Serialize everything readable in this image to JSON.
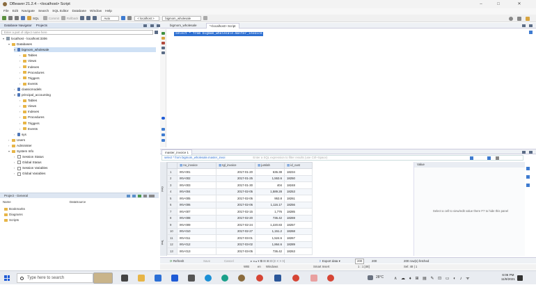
{
  "window": {
    "title": "DBeaver 21.2.4 - <localhost> Script"
  },
  "menu": [
    "File",
    "Edit",
    "Navigate",
    "Search",
    "SQL Editor",
    "Database",
    "Window",
    "Help"
  ],
  "toolbar": {
    "sql_label": "SQL",
    "commit_label": "Commit",
    "rollback_label": "Rollback",
    "auto_label": "Auto",
    "conn_combo": "< localhost >",
    "schema_combo": "bigmom_wholesale"
  },
  "navigator": {
    "header": "Database Navigator",
    "projects_tab": "Projects",
    "filter_placeholder": "Enter a part of object name here",
    "tree": [
      {
        "label": "localhost - localhost:3306",
        "level": 0,
        "kind": "srv",
        "open": true
      },
      {
        "label": "Databases",
        "level": 1,
        "kind": "folder",
        "open": true
      },
      {
        "label": "bigmom_wholesale",
        "level": 2,
        "kind": "db",
        "open": true,
        "selected": true
      },
      {
        "label": "Tables",
        "level": 3,
        "kind": "folder"
      },
      {
        "label": "Views",
        "level": 3,
        "kind": "folder"
      },
      {
        "label": "Indexes",
        "level": 3,
        "kind": "folder"
      },
      {
        "label": "Procedures",
        "level": 3,
        "kind": "folder"
      },
      {
        "label": "Triggers",
        "level": 3,
        "kind": "folder"
      },
      {
        "label": "Events",
        "level": 3,
        "kind": "folder"
      },
      {
        "label": "classicmodels",
        "level": 2,
        "kind": "db"
      },
      {
        "label": "principal_accounting",
        "level": 2,
        "kind": "db",
        "open": true
      },
      {
        "label": "Tables",
        "level": 3,
        "kind": "folder"
      },
      {
        "label": "Views",
        "level": 3,
        "kind": "folder"
      },
      {
        "label": "Indexes",
        "level": 3,
        "kind": "folder"
      },
      {
        "label": "Procedures",
        "level": 3,
        "kind": "folder"
      },
      {
        "label": "Triggers",
        "level": 3,
        "kind": "folder"
      },
      {
        "label": "Events",
        "level": 3,
        "kind": "folder"
      },
      {
        "label": "sys",
        "level": 2,
        "kind": "db"
      },
      {
        "label": "Users",
        "level": 1,
        "kind": "folder"
      },
      {
        "label": "Administer",
        "level": 1,
        "kind": "folder"
      },
      {
        "label": "System Info",
        "level": 1,
        "kind": "folder",
        "open": true
      },
      {
        "label": "Session Status",
        "level": 2,
        "kind": "table"
      },
      {
        "label": "Global Status",
        "level": 2,
        "kind": "table"
      },
      {
        "label": "Session Variables",
        "level": 2,
        "kind": "table"
      },
      {
        "label": "Global Variables",
        "level": 2,
        "kind": "table"
      }
    ]
  },
  "project": {
    "header": "Project - General",
    "col_name": "Name",
    "col_source": "DataSource",
    "items": [
      "Bookmarks",
      "Diagrams",
      "Scripts"
    ]
  },
  "editor": {
    "tabs": [
      "bigmom_wholesale",
      "*<localhost> Script"
    ],
    "sql": "select * from bigmom_wholesale.master_invoice"
  },
  "results": {
    "tab": "master_invoice 1",
    "filter_text": "select * from bigmom_wholesale.master_invoi",
    "filter_hint": "Enter a SQL expression to filter results (use Ctrl+Space)",
    "columns": [
      "no_invoice",
      "tgl_invoice",
      "jumlah",
      "id_cust"
    ],
    "rows": [
      [
        "1",
        "INV-001",
        "2017-01-20",
        "636.38",
        "18234"
      ],
      [
        "2",
        "INV-002",
        "2017-01-25",
        "1,553.6",
        "18250"
      ],
      [
        "3",
        "INV-003",
        "2017-01-30",
        "404",
        "18248"
      ],
      [
        "4",
        "INV-004",
        "2017-02-05",
        "1,589.28",
        "18253"
      ],
      [
        "5",
        "INV-005",
        "2017-02-05",
        "953.8",
        "18261"
      ],
      [
        "6",
        "INV-006",
        "2017-02-06",
        "1,116.17",
        "18256"
      ],
      [
        "7",
        "INV-007",
        "2017-02-15",
        "1,776",
        "18285"
      ],
      [
        "8",
        "INV-008",
        "2017-02-20",
        "736.42",
        "18269"
      ],
      [
        "9",
        "INV-009",
        "2017-02-24",
        "1,220.83",
        "18257"
      ],
      [
        "10",
        "INV-010",
        "2017-02-27",
        "1,151.2",
        "18268"
      ],
      [
        "11",
        "INV-011",
        "2017-03-01",
        "1,524.6",
        "18267"
      ],
      [
        "12",
        "INV-012",
        "2017-03-02",
        "1,864.6",
        "18289"
      ],
      [
        "13",
        "INV-013",
        "2017-03-05",
        "736.42",
        "18263"
      ]
    ],
    "value_panel_title": "Value",
    "value_panel_msg": "Select a cell to view/edit value there F7 to hide this panel",
    "footer": {
      "refresh": "Refresh",
      "save": "Save",
      "cancel": "Cancel",
      "export": "Export data",
      "limit": "200",
      "fetched": "200",
      "rows_msg": "200 row(s) fetched"
    },
    "vtabs": [
      "Grid",
      "Text"
    ]
  },
  "status": {
    "encoding": "WIB",
    "lang": "en",
    "os": "Windows",
    "insert": "Smart Insert",
    "pos": "1 : 1 [48]",
    "sel": "Sel: 48 | 1"
  },
  "taskbar": {
    "search_placeholder": "Type here to search",
    "weather": "28°C",
    "time": "6:06 PM",
    "date": "11/9/2021"
  }
}
